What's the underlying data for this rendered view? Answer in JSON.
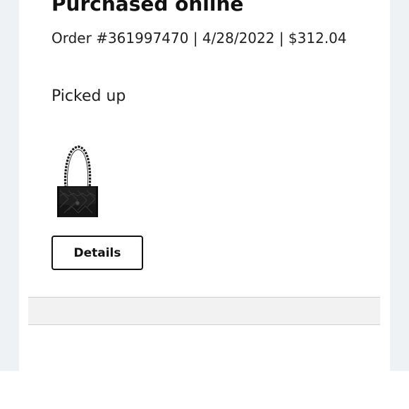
{
  "order": {
    "title": "Purchased online",
    "meta": "Order #361997470 | 4/28/2022 | $312.04",
    "status": "Picked up"
  },
  "product": {
    "image_icon": "quilted-shoulder-bag-image",
    "image_color": "#151515"
  },
  "actions": {
    "details_label": "Details"
  },
  "colors": {
    "page_background": "#eef2f5",
    "card_background": "#ffffff",
    "text": "#1a1a1a",
    "button_border": "#111111"
  }
}
